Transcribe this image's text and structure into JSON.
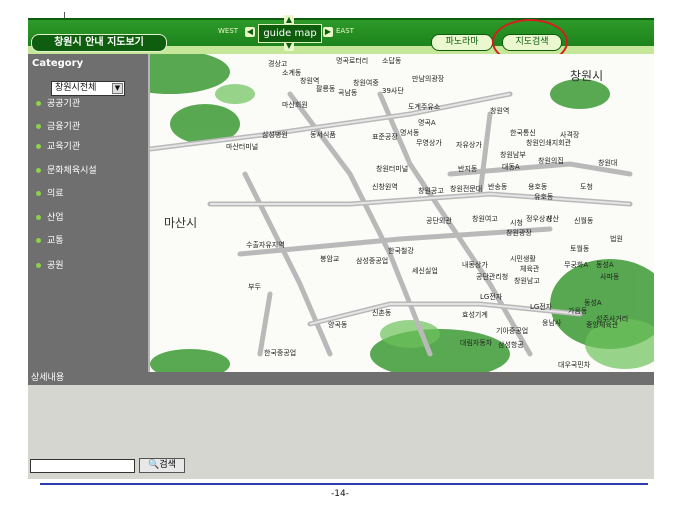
{
  "header": {
    "brand": "창원시 안내 지도보기",
    "west": "WEST",
    "east": "EAST",
    "guide_map": "guide map",
    "panorama": "파노라마",
    "map_search": "지도검색"
  },
  "sidebar": {
    "title": "Category",
    "select_value": "창원시전체",
    "items": [
      "공공기관",
      "금융기관",
      "교육기관",
      "문화체육시설",
      "의료",
      "산업",
      "교통",
      "공원"
    ]
  },
  "map": {
    "city_right": "창원시",
    "city_left": "마산시",
    "labels": [
      "경상고",
      "소계동",
      "창원역",
      "명곡로터리",
      "소답동",
      "팔룡동",
      "창원여중",
      "만남의광장",
      "곡남동",
      "39사단",
      "마산회원",
      "도계주유소",
      "명곡A",
      "명서동",
      "무영상가",
      "자유상가",
      "사격장",
      "한국통신",
      "창원역",
      "창원인쇄지회관",
      "마산터미널",
      "삼성병원",
      "동서식품",
      "표준공장",
      "창원남부",
      "창원터미널",
      "반지동",
      "대동A",
      "창원의집",
      "용호동",
      "신창원역",
      "창원공고",
      "창원전문대",
      "반송동",
      "유호동",
      "창원대",
      "도청",
      "공단외관",
      "창원여고",
      "정우상가",
      "시청",
      "성산",
      "창원광장",
      "법원",
      "수출자유지역",
      "한국철강",
      "신월동",
      "봉암교",
      "삼성중공업",
      "세신실업",
      "내동상가",
      "시민생활",
      "체육관",
      "토월동",
      "무궁화A",
      "동성A",
      "공단관리청",
      "창원남고",
      "사파동",
      "부두",
      "LG전자",
      "LG전자",
      "가음동",
      "동성A",
      "효성기계",
      "기아중공업",
      "웅남사",
      "중앙체육관",
      "양곡동",
      "신촌동",
      "대림자동차",
      "삼성항공",
      "한국중공업",
      "대우국민차",
      "성주사거리"
    ]
  },
  "detail": {
    "title": "상세내용",
    "search_placeholder": "",
    "search_button": "검색"
  },
  "footer": {
    "page": "-14-"
  },
  "colors": {
    "header_green": "#167a16",
    "highlight_red": "#d41f1f",
    "sidebar_gray": "#6f6f6f",
    "footer_line": "#2c3db0"
  }
}
